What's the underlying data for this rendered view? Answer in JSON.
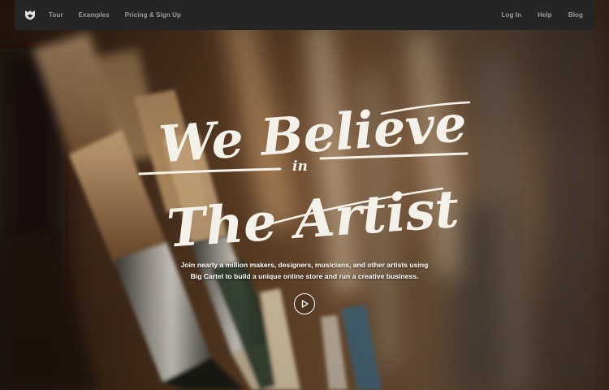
{
  "nav": {
    "logo_icon": "big-cartel-shield-logo",
    "left_links": [
      "Tour",
      "Examples",
      "Pricing & Sign Up"
    ],
    "right_links": [
      "Log In",
      "Help",
      "Blog"
    ]
  },
  "hero": {
    "headline_line1": "We Believe",
    "headline_line2": "in",
    "headline_line3": "The Artist",
    "tagline_line1": "Join nearly a million makers, designers, musicians, and other artists using",
    "tagline_line2": "Big Cartel to build a unique online store and run a creative business.",
    "play_icon": "play-icon"
  },
  "colors": {
    "navbar_bg": "#252525",
    "nav_text": "#9c9c9c",
    "headline_text": "#f4f0ea"
  }
}
